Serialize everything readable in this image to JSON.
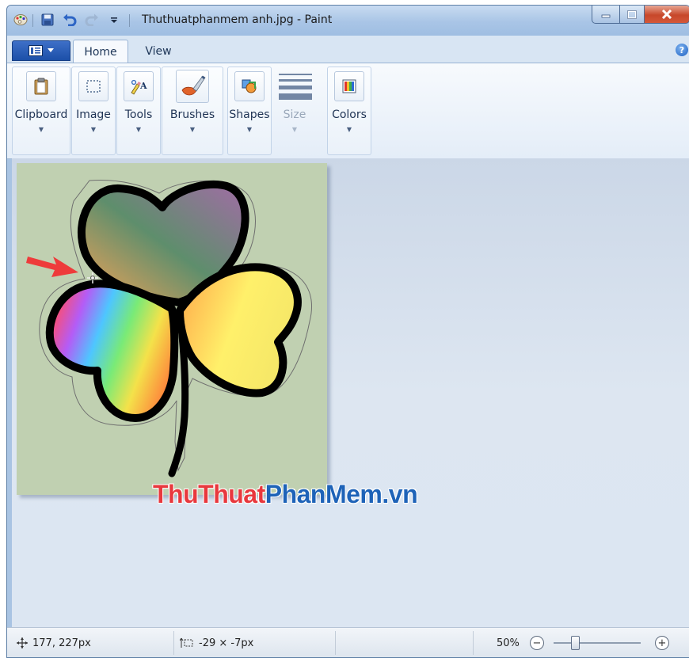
{
  "window": {
    "title": "Thuthuatphanmem anh.jpg - Paint"
  },
  "tabs": [
    {
      "label": "Home",
      "active": true
    },
    {
      "label": "View",
      "active": false
    }
  ],
  "ribbon_groups": [
    {
      "label": "Clipboard",
      "icon": "clipboard-icon"
    },
    {
      "label": "Image",
      "icon": "select-icon"
    },
    {
      "label": "Tools",
      "icon": "tools-icon"
    },
    {
      "label": "Brushes",
      "icon": "brush-icon"
    },
    {
      "label": "Shapes",
      "icon": "shapes-icon"
    },
    {
      "label": "Size",
      "icon": "size-icon",
      "disabled": true
    },
    {
      "label": "Colors",
      "icon": "colors-icon"
    }
  ],
  "canvas": {
    "background_color": "#c0d0b1"
  },
  "watermark": {
    "part1": "ThuThuat",
    "part2": "PhanMem.vn",
    "color1": "#e8383d",
    "color2": "#1e63b8"
  },
  "status": {
    "cursor_position": "177, 227px",
    "selection_size": "-29 × -7px",
    "zoom": "50%"
  }
}
